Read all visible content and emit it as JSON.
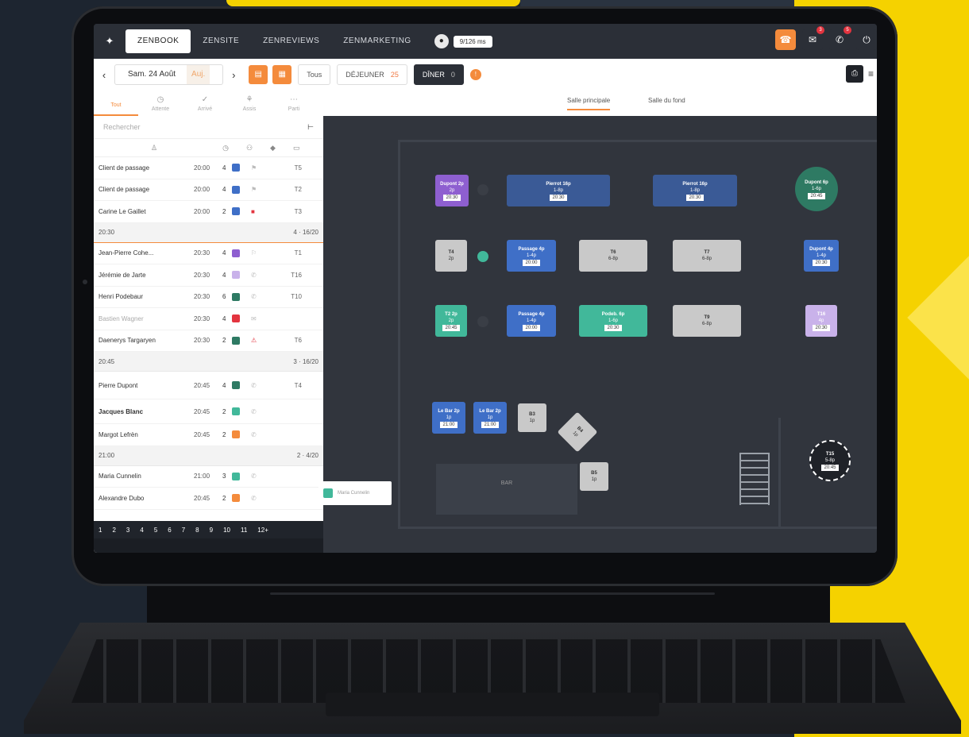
{
  "nav": {
    "tabs": [
      {
        "label": "ZENBOOK",
        "active": true
      },
      {
        "label": "ZENSITE",
        "active": false
      },
      {
        "label": "ZENREVIEWS",
        "active": false
      },
      {
        "label": "ZENMARKETING",
        "active": false
      }
    ],
    "pill": "9/126 ms",
    "badges": [
      "3",
      "5"
    ]
  },
  "toolbar": {
    "date": "Sam. 24 Août",
    "today": "Auj.",
    "services": [
      {
        "label": "Tous",
        "badge": ""
      },
      {
        "label": "DÉJEUNER",
        "badge": "25"
      },
      {
        "label": "DÎNER",
        "badge": "0",
        "active": true
      }
    ]
  },
  "subbar": {
    "tabs": [
      "Tout",
      "Attente",
      "Arrivé",
      "Assis",
      "Parti"
    ],
    "rooms": [
      "Salle principale",
      "Salle du fond"
    ]
  },
  "left": {
    "search_placeholder": "Rechercher",
    "rows_a": [
      {
        "name": "Client de passage",
        "time": "20:00",
        "count": "4",
        "color": "#3f6fc7",
        "table": "T5"
      },
      {
        "name": "Client de passage",
        "time": "20:00",
        "count": "4",
        "color": "#3f6fc7",
        "table": "T2"
      },
      {
        "name": "Carine Le Gaillet",
        "time": "20:00",
        "count": "2",
        "color": "#3f6fc7",
        "table": "T3"
      }
    ],
    "group1": {
      "time": "20:30",
      "info": "4 · 16/20"
    },
    "rows_b": [
      {
        "name": "Jean-Pierre Cohe...",
        "time": "20:30",
        "count": "4",
        "color": "#8e5fd0",
        "table": "T1"
      },
      {
        "name": "Jérémie de Jarte",
        "time": "20:30",
        "count": "4",
        "color": "#c9b2ea",
        "table": "T16"
      },
      {
        "name": "Henri Podebaur",
        "time": "20:30",
        "count": "6",
        "color": "#2e7a63",
        "table": "T10"
      },
      {
        "name": "Bastien Wagner",
        "time": "20:30",
        "count": "4",
        "color": "#e3343f",
        "table": ""
      },
      {
        "name": "Daenerys Targaryen",
        "time": "20:30",
        "count": "2",
        "color": "#2e7a63",
        "table": "T6"
      }
    ],
    "group2": {
      "time": "20:45",
      "info": "3 · 16/20"
    },
    "rows_c": [
      {
        "name": "Pierre Dupont",
        "time": "20:45",
        "count": "4",
        "color": "#2e7a63",
        "table": "T4"
      },
      {
        "name": "Jacques Blanc",
        "time": "20:45",
        "count": "2",
        "color": "#41b89a",
        "table": ""
      },
      {
        "name": "Margot Lefrèn",
        "time": "20:45",
        "count": "2",
        "color": "#f48b3c",
        "table": ""
      }
    ],
    "group3": {
      "time": "21:00",
      "info": "2 · 4/20"
    },
    "rows_d": [
      {
        "name": "Maria Cunnelin",
        "time": "21:00",
        "count": "3",
        "color": "#41b89a",
        "table": ""
      },
      {
        "name": "Alexandre Dubo",
        "time": "20:45",
        "count": "2",
        "color": "#f48b3c",
        "table": ""
      }
    ],
    "pager": [
      "1",
      "2",
      "3",
      "4",
      "5",
      "6",
      "7",
      "8",
      "9",
      "10",
      "11",
      "12+"
    ]
  },
  "floor": {
    "popup": "Maria Cunnelin",
    "bar_label": "BAR",
    "tables": [
      {
        "name": "Dupont 2p",
        "count": "2p",
        "time": "20:30"
      },
      {
        "name": "Pierrot 16p",
        "count": "1-8p",
        "time": "20:30"
      },
      {
        "name": "Pierrot 16p",
        "count": "1-8p",
        "time": "20:30"
      },
      {
        "name": "Dupont 6p",
        "count": "1-6p",
        "time": "20:45"
      },
      {
        "name": "T4",
        "count": "2p",
        "time": ""
      },
      {
        "name": "Passage 4p",
        "count": "1-4p",
        "time": "20:00"
      },
      {
        "name": "T6",
        "count": "6-8p",
        "time": ""
      },
      {
        "name": "T7",
        "count": "6-8p",
        "time": ""
      },
      {
        "name": "Dupont 4p",
        "count": "1-4p",
        "time": "20:30"
      },
      {
        "name": "T2 2p",
        "count": "2p",
        "time": "20:45"
      },
      {
        "name": "Passage 4p",
        "count": "1-4p",
        "time": "20:00"
      },
      {
        "name": "Podeb. 6p",
        "count": "1-6p",
        "time": "20:30"
      },
      {
        "name": "T9",
        "count": "6-8p",
        "time": ""
      },
      {
        "name": "T16",
        "count": "4p",
        "time": "20:30"
      },
      {
        "name": "Le Bar 2p",
        "count": "1p",
        "time": "21:00"
      },
      {
        "name": "Le Bar 2p",
        "count": "1p",
        "time": "21:00"
      },
      {
        "name": "B3",
        "count": "1p",
        "time": ""
      },
      {
        "name": "B4",
        "count": "1p",
        "time": ""
      },
      {
        "name": "B5",
        "count": "1p",
        "time": ""
      },
      {
        "name": "T15",
        "count": "5-8p",
        "time": "20:45"
      }
    ]
  },
  "colors": {
    "accent": "#f48b3c",
    "background_yellow": "#f5d200"
  }
}
